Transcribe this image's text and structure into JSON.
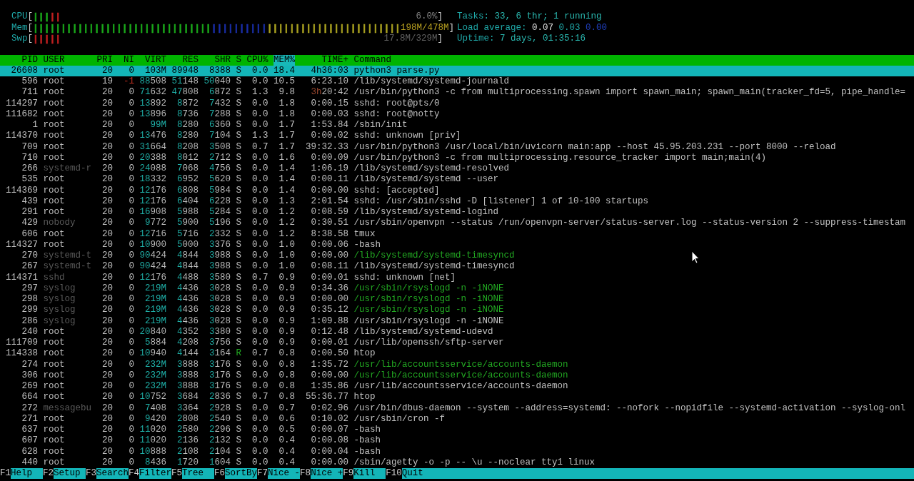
{
  "meters": [
    {
      "label": "CPU",
      "open": "[",
      "close": "]",
      "reading": "6.0%",
      "segments": [
        {
          "color": "#1aa81a",
          "bars": "|||"
        },
        {
          "color": "#c02020",
          "bars": "||"
        }
      ]
    },
    {
      "label": "Mem",
      "open": "[",
      "close": "]",
      "reading": "198M/478M",
      "segments": [
        {
          "color": "#1aa81a",
          "bars": "||||||||||||||||||||||||||||||||"
        },
        {
          "color": "#1a2ea8",
          "bars": "||||||||||"
        },
        {
          "color": "#a8a020",
          "bars": "||||||||||||||||||||||||"
        }
      ]
    },
    {
      "label": "Swp",
      "open": "[",
      "close": "]",
      "reading": "17.8M/329M",
      "segments": [
        {
          "color": "#c02020",
          "bars": "|||||"
        }
      ]
    }
  ],
  "summary": {
    "tasks": {
      "label": "Tasks:",
      "value": "33, 6 thr; 1 running"
    },
    "load_average": {
      "label": "Load average:",
      "values": [
        "0.07",
        "0.03",
        "0.00"
      ]
    },
    "uptime": {
      "label": "Uptime:",
      "value": "7 days, 01:35:16"
    }
  },
  "table": {
    "columns": [
      {
        "label": "PID",
        "selected": false
      },
      {
        "label": "USER",
        "selected": false
      },
      {
        "label": "PRI",
        "selected": false
      },
      {
        "label": "NI",
        "selected": false
      },
      {
        "label": "VIRT",
        "selected": false
      },
      {
        "label": "RES",
        "selected": false
      },
      {
        "label": "SHR",
        "selected": false
      },
      {
        "label": "S",
        "selected": false
      },
      {
        "label": "CPU%",
        "selected": false
      },
      {
        "label": "MEM%",
        "selected": true
      },
      {
        "label": "TIME+",
        "selected": false
      },
      {
        "label": "Command",
        "selected": false
      }
    ],
    "rows": [
      {
        "pid": "26608",
        "user": "root",
        "pri": "20",
        "ni": "0",
        "virt": "103M",
        "res": "89948",
        "shr": "8388",
        "s": "S",
        "cpu": "0.0",
        "mem": "18.4",
        "time": "4h36:03",
        "command": "python3 parse.py",
        "selected": true
      },
      {
        "pid": "596",
        "user": "root",
        "pri": "19",
        "ni": "-1",
        "virt": "88508",
        "res": "51148",
        "shr": "50040",
        "s": "S",
        "cpu": "0.0",
        "mem": "10.5",
        "time": "6:23.10",
        "command": "/lib/systemd/systemd-journald",
        "selected": false,
        "user_dimmed": false,
        "thread": false,
        "running": false
      },
      {
        "pid": "711",
        "user": "root",
        "pri": "20",
        "ni": "0",
        "virt": "71632",
        "res": "47808",
        "shr": "6872",
        "s": "S",
        "cpu": "1.3",
        "mem": "9.8",
        "time": "3h20:42",
        "command": "/usr/bin/python3 -c from multiprocessing.spawn import spawn_main; spawn_main(tracker_fd=5, pipe_handle=",
        "selected": false,
        "user_dimmed": false,
        "thread": false,
        "running": false
      },
      {
        "pid": "114297",
        "user": "root",
        "pri": "20",
        "ni": "0",
        "virt": "13892",
        "res": "8872",
        "shr": "7432",
        "s": "S",
        "cpu": "0.0",
        "mem": "1.8",
        "time": "0:00.15",
        "command": "sshd: root@pts/0",
        "selected": false,
        "user_dimmed": false,
        "thread": false,
        "running": false
      },
      {
        "pid": "111682",
        "user": "root",
        "pri": "20",
        "ni": "0",
        "virt": "13896",
        "res": "8736",
        "shr": "7288",
        "s": "S",
        "cpu": "0.0",
        "mem": "1.8",
        "time": "0:00.03",
        "command": "sshd: root@notty",
        "selected": false,
        "user_dimmed": false,
        "thread": false,
        "running": false
      },
      {
        "pid": "1",
        "user": "root",
        "pri": "20",
        "ni": "0",
        "virt": "99M",
        "res": "8280",
        "shr": "6360",
        "s": "S",
        "cpu": "0.0",
        "mem": "1.7",
        "time": "1:53.84",
        "command": "/sbin/init",
        "selected": false,
        "user_dimmed": false,
        "thread": false,
        "running": false
      },
      {
        "pid": "114370",
        "user": "root",
        "pri": "20",
        "ni": "0",
        "virt": "13476",
        "res": "8280",
        "shr": "7104",
        "s": "S",
        "cpu": "1.3",
        "mem": "1.7",
        "time": "0:00.02",
        "command": "sshd: unknown [priv]",
        "selected": false,
        "user_dimmed": false,
        "thread": false,
        "running": false
      },
      {
        "pid": "709",
        "user": "root",
        "pri": "20",
        "ni": "0",
        "virt": "31664",
        "res": "8208",
        "shr": "3508",
        "s": "S",
        "cpu": "0.7",
        "mem": "1.7",
        "time": "39:32.33",
        "command": "/usr/bin/python3 /usr/local/bin/uvicorn main:app --host 45.95.203.231 --port 8000 --reload",
        "selected": false,
        "user_dimmed": false,
        "thread": false,
        "running": false
      },
      {
        "pid": "710",
        "user": "root",
        "pri": "20",
        "ni": "0",
        "virt": "20388",
        "res": "8012",
        "shr": "2712",
        "s": "S",
        "cpu": "0.0",
        "mem": "1.6",
        "time": "0:00.09",
        "command": "/usr/bin/python3 -c from multiprocessing.resource_tracker import main;main(4)",
        "selected": false,
        "user_dimmed": false,
        "thread": false,
        "running": false
      },
      {
        "pid": "266",
        "user": "systemd-r",
        "pri": "20",
        "ni": "0",
        "virt": "24088",
        "res": "7068",
        "shr": "4756",
        "s": "S",
        "cpu": "0.0",
        "mem": "1.4",
        "time": "1:06.19",
        "command": "/lib/systemd/systemd-resolved",
        "selected": false,
        "user_dimmed": true,
        "thread": false,
        "running": false
      },
      {
        "pid": "535",
        "user": "root",
        "pri": "20",
        "ni": "0",
        "virt": "18332",
        "res": "6952",
        "shr": "5620",
        "s": "S",
        "cpu": "0.0",
        "mem": "1.4",
        "time": "0:00.11",
        "command": "/lib/systemd/systemd --user",
        "selected": false,
        "user_dimmed": false,
        "thread": false,
        "running": false
      },
      {
        "pid": "114369",
        "user": "root",
        "pri": "20",
        "ni": "0",
        "virt": "12176",
        "res": "6808",
        "shr": "5984",
        "s": "S",
        "cpu": "0.0",
        "mem": "1.4",
        "time": "0:00.00",
        "command": "sshd: [accepted]",
        "selected": false,
        "user_dimmed": false,
        "thread": false,
        "running": false
      },
      {
        "pid": "439",
        "user": "root",
        "pri": "20",
        "ni": "0",
        "virt": "12176",
        "res": "6404",
        "shr": "6228",
        "s": "S",
        "cpu": "0.0",
        "mem": "1.3",
        "time": "2:01.54",
        "command": "sshd: /usr/sbin/sshd -D [listener] 1 of 10-100 startups",
        "selected": false,
        "user_dimmed": false,
        "thread": false,
        "running": false
      },
      {
        "pid": "291",
        "user": "root",
        "pri": "20",
        "ni": "0",
        "virt": "16908",
        "res": "5988",
        "shr": "5284",
        "s": "S",
        "cpu": "0.0",
        "mem": "1.2",
        "time": "0:08.59",
        "command": "/lib/systemd/systemd-logind",
        "selected": false,
        "user_dimmed": false,
        "thread": false,
        "running": false
      },
      {
        "pid": "429",
        "user": "nobody",
        "pri": "20",
        "ni": "0",
        "virt": "9772",
        "res": "5900",
        "shr": "5196",
        "s": "S",
        "cpu": "0.0",
        "mem": "1.2",
        "time": "0:30.51",
        "command": "/usr/sbin/openvpn --status /run/openvpn-server/status-server.log --status-version 2 --suppress-timestam",
        "selected": false,
        "user_dimmed": true,
        "thread": false,
        "running": false
      },
      {
        "pid": "606",
        "user": "root",
        "pri": "20",
        "ni": "0",
        "virt": "12716",
        "res": "5716",
        "shr": "2332",
        "s": "S",
        "cpu": "0.0",
        "mem": "1.2",
        "time": "8:38.58",
        "command": "tmux",
        "selected": false,
        "user_dimmed": false,
        "thread": false,
        "running": false
      },
      {
        "pid": "114327",
        "user": "root",
        "pri": "20",
        "ni": "0",
        "virt": "10900",
        "res": "5000",
        "shr": "3376",
        "s": "S",
        "cpu": "0.0",
        "mem": "1.0",
        "time": "0:00.06",
        "command": "-bash",
        "selected": false,
        "user_dimmed": false,
        "thread": false,
        "running": false
      },
      {
        "pid": "270",
        "user": "systemd-t",
        "pri": "20",
        "ni": "0",
        "virt": "90424",
        "res": "4844",
        "shr": "3988",
        "s": "S",
        "cpu": "0.0",
        "mem": "1.0",
        "time": "0:00.00",
        "command": "/lib/systemd/systemd-timesyncd",
        "selected": false,
        "user_dimmed": true,
        "thread": true,
        "running": false
      },
      {
        "pid": "267",
        "user": "systemd-t",
        "pri": "20",
        "ni": "0",
        "virt": "90424",
        "res": "4844",
        "shr": "3988",
        "s": "S",
        "cpu": "0.0",
        "mem": "1.0",
        "time": "0:08.11",
        "command": "/lib/systemd/systemd-timesyncd",
        "selected": false,
        "user_dimmed": true,
        "thread": false,
        "running": false
      },
      {
        "pid": "114371",
        "user": "sshd",
        "pri": "20",
        "ni": "0",
        "virt": "12176",
        "res": "4488",
        "shr": "3580",
        "s": "S",
        "cpu": "0.7",
        "mem": "0.9",
        "time": "0:00.01",
        "command": "sshd: unknown [net]",
        "selected": false,
        "user_dimmed": true,
        "thread": false,
        "running": false
      },
      {
        "pid": "297",
        "user": "syslog",
        "pri": "20",
        "ni": "0",
        "virt": "219M",
        "res": "4436",
        "shr": "3028",
        "s": "S",
        "cpu": "0.0",
        "mem": "0.9",
        "time": "0:34.36",
        "command": "/usr/sbin/rsyslogd -n -iNONE",
        "selected": false,
        "user_dimmed": true,
        "thread": true,
        "running": false
      },
      {
        "pid": "298",
        "user": "syslog",
        "pri": "20",
        "ni": "0",
        "virt": "219M",
        "res": "4436",
        "shr": "3028",
        "s": "S",
        "cpu": "0.0",
        "mem": "0.9",
        "time": "0:00.00",
        "command": "/usr/sbin/rsyslogd -n -iNONE",
        "selected": false,
        "user_dimmed": true,
        "thread": true,
        "running": false
      },
      {
        "pid": "299",
        "user": "syslog",
        "pri": "20",
        "ni": "0",
        "virt": "219M",
        "res": "4436",
        "shr": "3028",
        "s": "S",
        "cpu": "0.0",
        "mem": "0.9",
        "time": "0:35.12",
        "command": "/usr/sbin/rsyslogd -n -iNONE",
        "selected": false,
        "user_dimmed": true,
        "thread": true,
        "running": false
      },
      {
        "pid": "286",
        "user": "syslog",
        "pri": "20",
        "ni": "0",
        "virt": "219M",
        "res": "4436",
        "shr": "3028",
        "s": "S",
        "cpu": "0.0",
        "mem": "0.9",
        "time": "1:09.88",
        "command": "/usr/sbin/rsyslogd -n -iNONE",
        "selected": false,
        "user_dimmed": true,
        "thread": false,
        "running": false
      },
      {
        "pid": "240",
        "user": "root",
        "pri": "20",
        "ni": "0",
        "virt": "20840",
        "res": "4352",
        "shr": "3380",
        "s": "S",
        "cpu": "0.0",
        "mem": "0.9",
        "time": "0:12.48",
        "command": "/lib/systemd/systemd-udevd",
        "selected": false,
        "user_dimmed": false,
        "thread": false,
        "running": false
      },
      {
        "pid": "111709",
        "user": "root",
        "pri": "20",
        "ni": "0",
        "virt": "5884",
        "res": "4208",
        "shr": "3756",
        "s": "S",
        "cpu": "0.0",
        "mem": "0.9",
        "time": "0:00.01",
        "command": "/usr/lib/openssh/sftp-server",
        "selected": false,
        "user_dimmed": false,
        "thread": false,
        "running": false
      },
      {
        "pid": "114338",
        "user": "root",
        "pri": "20",
        "ni": "0",
        "virt": "10940",
        "res": "4144",
        "shr": "3164",
        "s": "R",
        "cpu": "0.7",
        "mem": "0.8",
        "time": "0:00.50",
        "command": "htop",
        "selected": false,
        "user_dimmed": false,
        "thread": false,
        "running": true
      },
      {
        "pid": "274",
        "user": "root",
        "pri": "20",
        "ni": "0",
        "virt": "232M",
        "res": "3888",
        "shr": "3176",
        "s": "S",
        "cpu": "0.0",
        "mem": "0.8",
        "time": "1:35.72",
        "command": "/usr/lib/accountsservice/accounts-daemon",
        "selected": false,
        "user_dimmed": false,
        "thread": true,
        "running": false
      },
      {
        "pid": "306",
        "user": "root",
        "pri": "20",
        "ni": "0",
        "virt": "232M",
        "res": "3888",
        "shr": "3176",
        "s": "S",
        "cpu": "0.0",
        "mem": "0.8",
        "time": "0:00.00",
        "command": "/usr/lib/accountsservice/accounts-daemon",
        "selected": false,
        "user_dimmed": false,
        "thread": true,
        "running": false
      },
      {
        "pid": "269",
        "user": "root",
        "pri": "20",
        "ni": "0",
        "virt": "232M",
        "res": "3888",
        "shr": "3176",
        "s": "S",
        "cpu": "0.0",
        "mem": "0.8",
        "time": "1:35.86",
        "command": "/usr/lib/accountsservice/accounts-daemon",
        "selected": false,
        "user_dimmed": false,
        "thread": false,
        "running": false
      },
      {
        "pid": "664",
        "user": "root",
        "pri": "20",
        "ni": "0",
        "virt": "10752",
        "res": "3684",
        "shr": "2836",
        "s": "S",
        "cpu": "0.7",
        "mem": "0.8",
        "time": "55:36.77",
        "command": "htop",
        "selected": false,
        "user_dimmed": false,
        "thread": false,
        "running": false
      },
      {
        "pid": "272",
        "user": "messagebu",
        "pri": "20",
        "ni": "0",
        "virt": "7408",
        "res": "3364",
        "shr": "2928",
        "s": "S",
        "cpu": "0.0",
        "mem": "0.7",
        "time": "0:02.96",
        "command": "/usr/bin/dbus-daemon --system --address=systemd: --nofork --nopidfile --systemd-activation --syslog-onl",
        "selected": false,
        "user_dimmed": true,
        "thread": false,
        "running": false
      },
      {
        "pid": "271",
        "user": "root",
        "pri": "20",
        "ni": "0",
        "virt": "9420",
        "res": "2808",
        "shr": "2540",
        "s": "S",
        "cpu": "0.0",
        "mem": "0.6",
        "time": "0:10.02",
        "command": "/usr/sbin/cron -f",
        "selected": false,
        "user_dimmed": false,
        "thread": false,
        "running": false
      },
      {
        "pid": "637",
        "user": "root",
        "pri": "20",
        "ni": "0",
        "virt": "11020",
        "res": "2580",
        "shr": "2296",
        "s": "S",
        "cpu": "0.0",
        "mem": "0.5",
        "time": "0:00.07",
        "command": "-bash",
        "selected": false,
        "user_dimmed": false,
        "thread": false,
        "running": false
      },
      {
        "pid": "607",
        "user": "root",
        "pri": "20",
        "ni": "0",
        "virt": "11020",
        "res": "2136",
        "shr": "2132",
        "s": "S",
        "cpu": "0.0",
        "mem": "0.4",
        "time": "0:00.08",
        "command": "-bash",
        "selected": false,
        "user_dimmed": false,
        "thread": false,
        "running": false
      },
      {
        "pid": "628",
        "user": "root",
        "pri": "20",
        "ni": "0",
        "virt": "10888",
        "res": "2108",
        "shr": "2104",
        "s": "S",
        "cpu": "0.0",
        "mem": "0.4",
        "time": "0:00.04",
        "command": "-bash",
        "selected": false,
        "user_dimmed": false,
        "thread": false,
        "running": false
      },
      {
        "pid": "440",
        "user": "root",
        "pri": "20",
        "ni": "0",
        "virt": "8436",
        "res": "1720",
        "shr": "1604",
        "s": "S",
        "cpu": "0.0",
        "mem": "0.4",
        "time": "0:00.00",
        "command": "/sbin/agetty -o -p -- \\u --noclear tty1 linux",
        "selected": false,
        "user_dimmed": false,
        "thread": false,
        "running": false
      }
    ]
  },
  "function_keys": [
    {
      "key": "F1",
      "label": "Help"
    },
    {
      "key": "F2",
      "label": "Setup"
    },
    {
      "key": "F3",
      "label": "Search"
    },
    {
      "key": "F4",
      "label": "Filter"
    },
    {
      "key": "F5",
      "label": "Tree"
    },
    {
      "key": "F6",
      "label": "SortBy"
    },
    {
      "key": "F7",
      "label": "Nice -"
    },
    {
      "key": "F8",
      "label": "Nice +"
    },
    {
      "key": "F9",
      "label": "Kill"
    },
    {
      "key": "F10",
      "label": "Quit"
    }
  ]
}
